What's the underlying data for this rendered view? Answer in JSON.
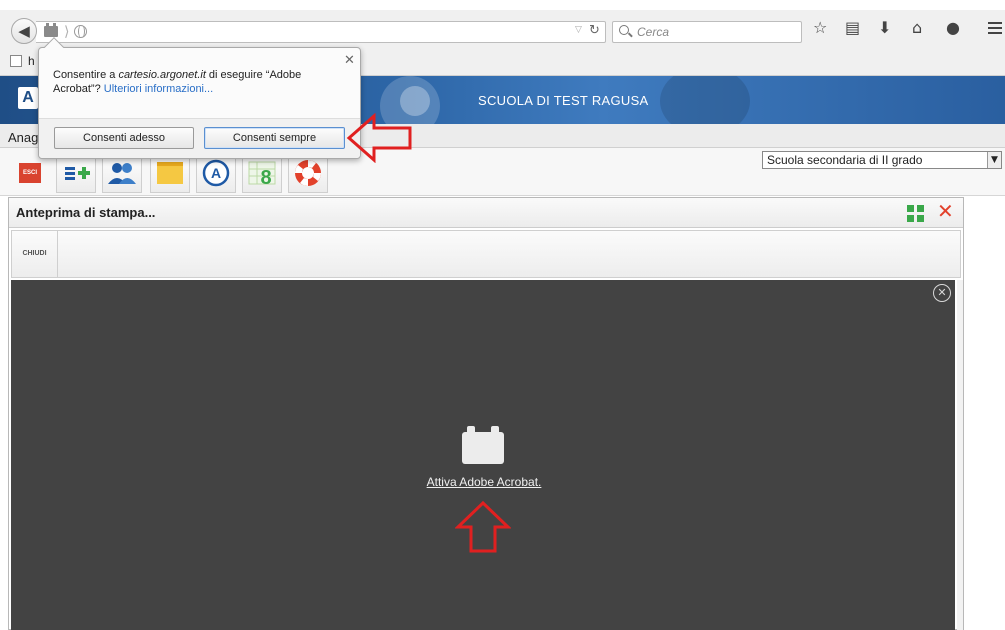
{
  "browser": {
    "search_placeholder": "Cerca",
    "bookmark_text": "h"
  },
  "app": {
    "logo_letter": "A",
    "school_name": "SCUOLA DI TEST RAGUSA",
    "menu_label": "Anag",
    "esci_label": "ESCI",
    "school_level": "Scuola secondaria di II grado",
    "school_level_options": [
      "Scuola secondaria di II grado"
    ]
  },
  "permission_popup": {
    "message_prefix": "Consentire a ",
    "message_domain": "cartesio.argonet.it",
    "message_suffix": " di eseguire “Adobe Acrobat”? ",
    "more_info_link": "Ulteriori informazioni...",
    "allow_now_label": "Consenti adesso",
    "allow_always_label": "Consenti sempre"
  },
  "preview": {
    "title": "Anteprima di stampa...",
    "close_label": "CHIUDI",
    "activate_link": "Attiva Adobe Acrobat."
  },
  "colors": {
    "header_blue": "#2d66a7",
    "pdf_bg": "#434343",
    "annotation_red": "#e02020",
    "close_red": "#e2412b",
    "expand_green": "#3aa84a"
  }
}
